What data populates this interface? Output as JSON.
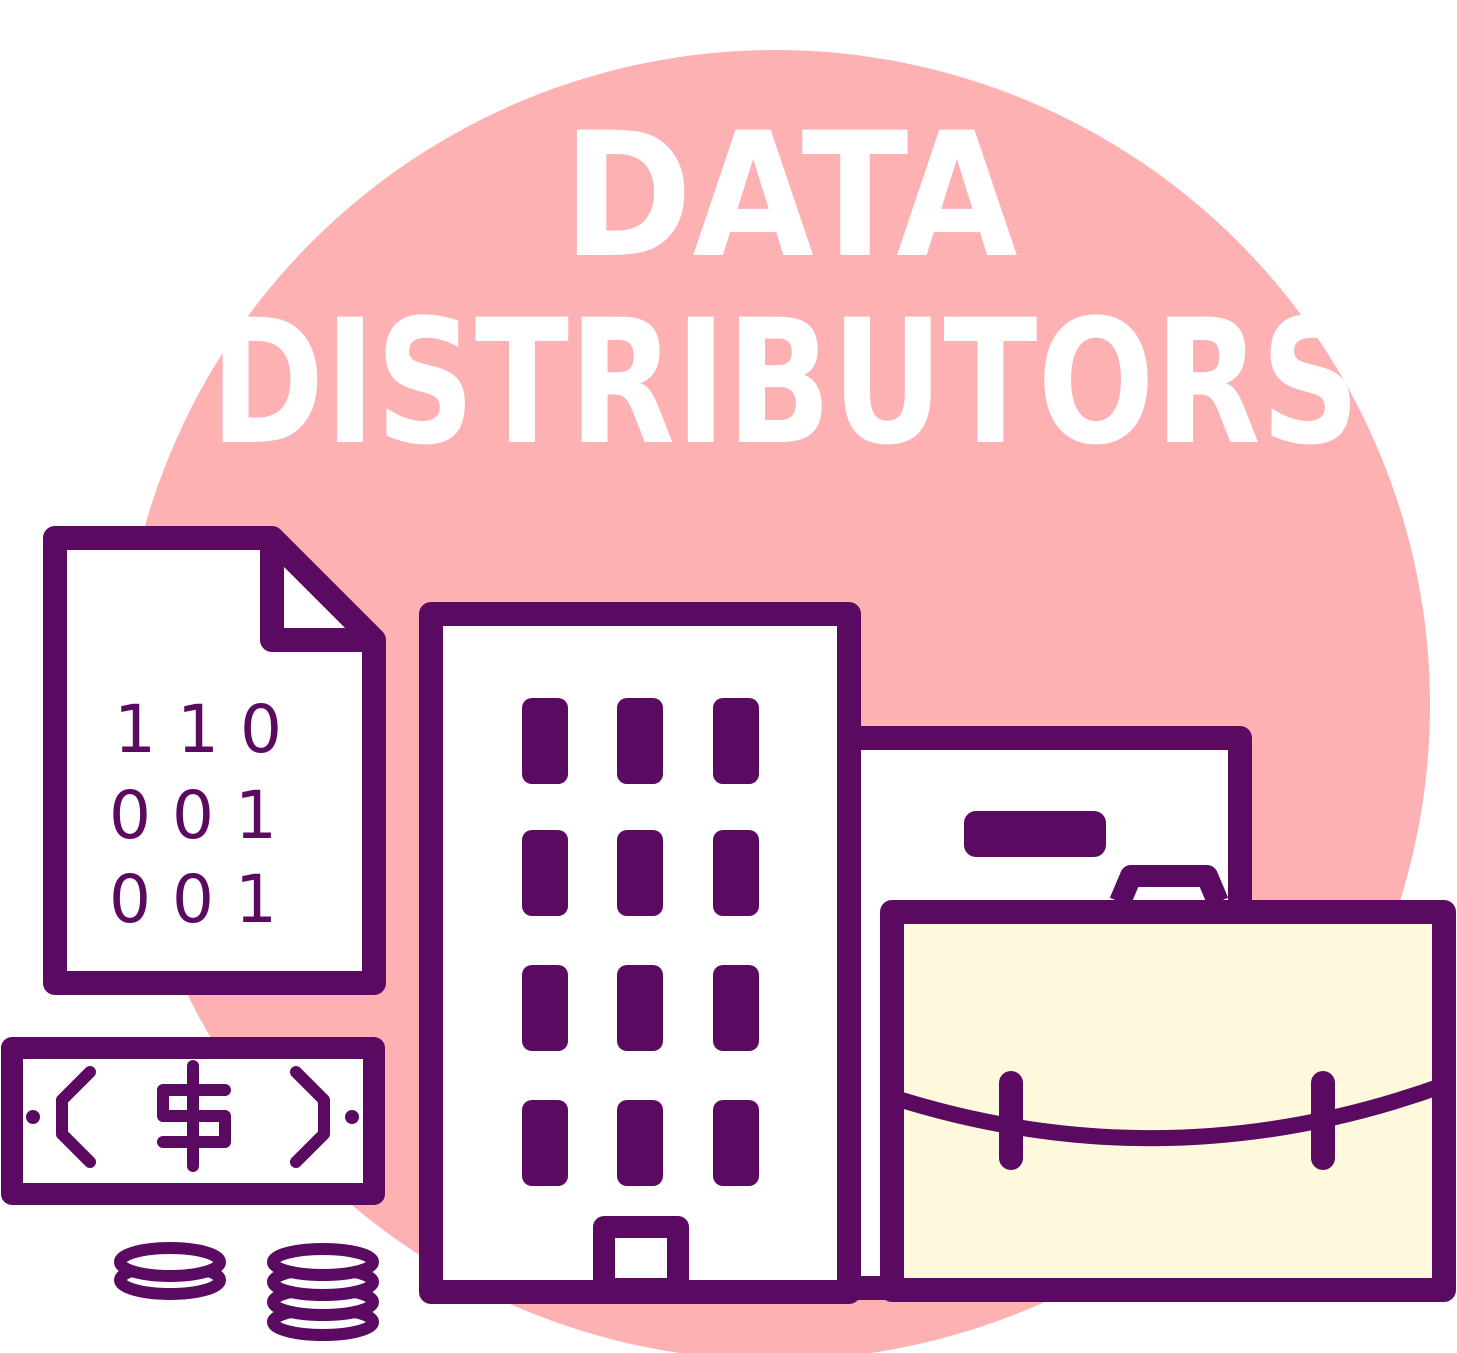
{
  "title": {
    "line1": "DATA",
    "line2": "DISTRIBUTORS"
  },
  "document": {
    "rows": [
      "1 1 0",
      "0 0 1",
      "0 0 1"
    ]
  },
  "banknote": {
    "symbol": "$"
  },
  "colors": {
    "outline": "#5a0a60",
    "circle": "#fdb1b3",
    "fill_white": "#ffffff",
    "briefcase_fill": "#fef9dc",
    "title_text": "#ffffff"
  },
  "icons": [
    "binary-document-icon",
    "banknote-icon",
    "coin-stack-icon",
    "office-building-icon",
    "warehouse-icon",
    "briefcase-icon"
  ]
}
